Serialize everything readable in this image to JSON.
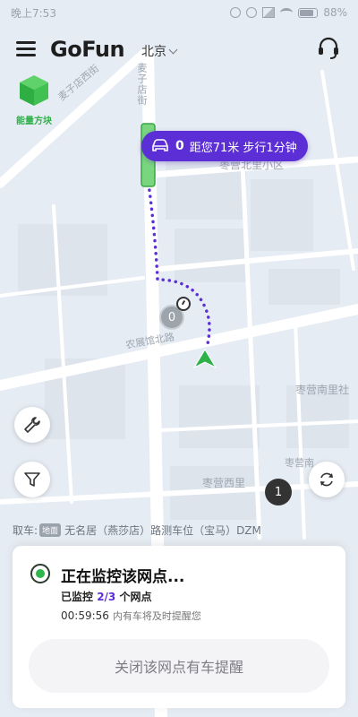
{
  "status_bar": {
    "time": "晚上7:53",
    "battery": "88%"
  },
  "header": {
    "logo": "GoFun",
    "city": "北京"
  },
  "energy": {
    "label": "能量方块"
  },
  "car_tip": {
    "count": "0",
    "text": "距您71米 步行1分钟"
  },
  "map_labels": {
    "road_vertical": "麦子店街",
    "road_diag": "麦子店西街",
    "area_north": "枣营北里小区",
    "road_south": "农展馆北路",
    "area_south_east": "枣营南里社",
    "area_south": "枣营西里",
    "area_south2": "枣营南",
    "gray_cluster": "0",
    "dark_cluster": "1"
  },
  "pickup": {
    "prefix": "取车:",
    "tag": "地面",
    "location": "无名居（燕莎店）路测车位（宝马）DZM"
  },
  "card": {
    "title": "正在监控该网点...",
    "monitor_prefix": "已监控 ",
    "monitor_count": "2/3",
    "monitor_suffix": " 个网点",
    "timer": "00:59:56",
    "timer_sub": "内有车将及时提醒您",
    "close_label": "关闭该网点有车提醒"
  },
  "colors": {
    "accent": "#5c2fd6",
    "green": "#30b64b"
  }
}
